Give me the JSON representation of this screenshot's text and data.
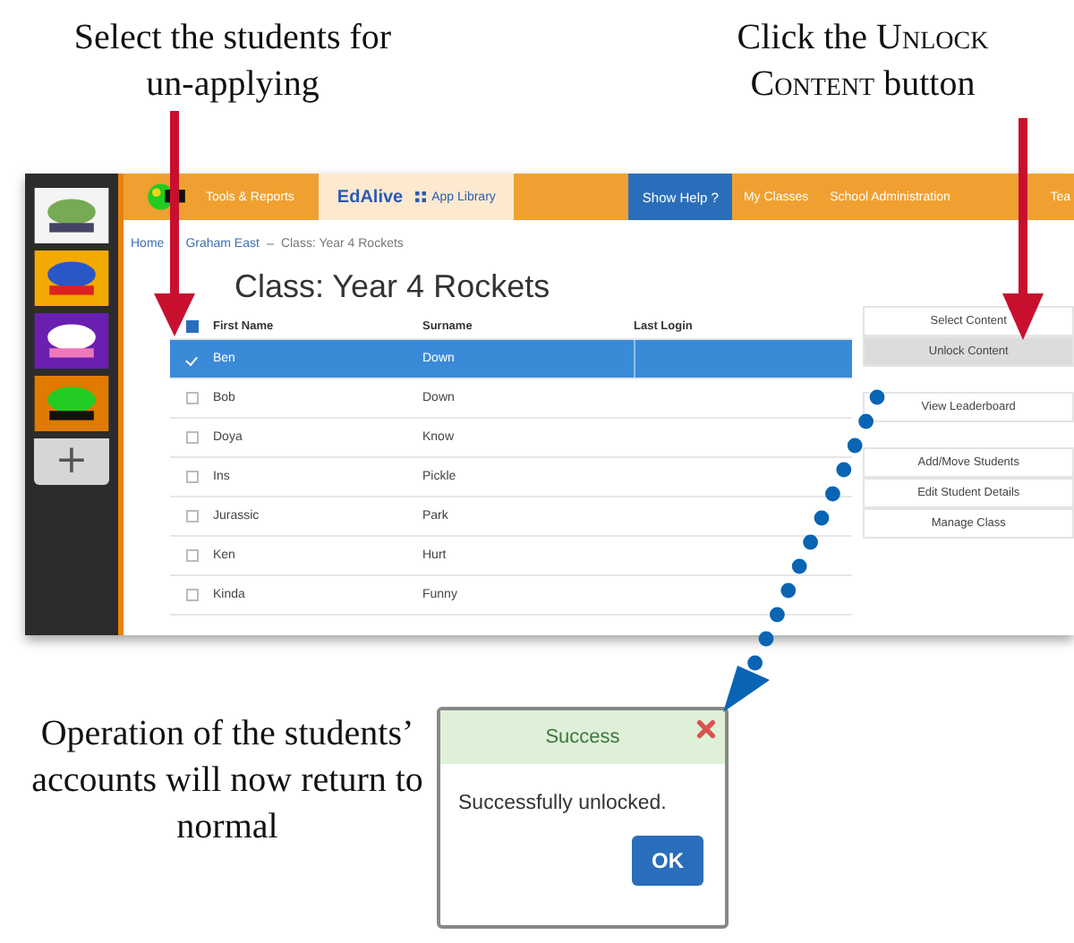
{
  "captions": {
    "top_left": "Select the students for un-applying",
    "top_right": {
      "before": "Click the",
      "emphasis": "Unlock Content",
      "after": "button"
    },
    "bottom_left": "Operation of the students’ accounts will now return to normal"
  },
  "sidebar": {
    "add_tab": "+"
  },
  "top_bar": [
    {
      "kind": "brand",
      "label": "Tools & Reports"
    },
    {
      "kind": "tab",
      "label": "EdAlive",
      "sub": "App Library"
    },
    {
      "kind": "help",
      "label": "Show Help ?"
    },
    {
      "kind": "link",
      "label": "My Classes"
    },
    {
      "kind": "link",
      "label": "School Administration"
    },
    {
      "kind": "link",
      "label": "Tea"
    }
  ],
  "breadcrumb": [
    "Home",
    "Graham East",
    "Class: Year 4 Rockets"
  ],
  "title": "Class: Year 4 Rockets",
  "table": {
    "header_checked": true,
    "columns": [
      "First Name",
      "Surname",
      "Last Login"
    ],
    "rows": [
      {
        "first": "Ben",
        "surname": "Down",
        "selected": true
      },
      {
        "first": "Bob",
        "surname": "Down",
        "selected": false
      },
      {
        "first": "Doya",
        "surname": "Know",
        "selected": false
      },
      {
        "first": "Ins",
        "surname": "Pickle",
        "selected": false
      },
      {
        "first": "Jurassic",
        "surname": "Park",
        "selected": false
      },
      {
        "first": "Ken",
        "surname": "Hurt",
        "selected": false
      },
      {
        "first": "Kinda",
        "surname": "Funny",
        "selected": false
      }
    ]
  },
  "actions": [
    [
      {
        "label": "Select Content",
        "pressed": false
      },
      {
        "label": "Unlock Content",
        "pressed": true
      }
    ],
    [
      {
        "label": "View Leaderboard",
        "pressed": false
      }
    ],
    [
      {
        "label": "Add/Move Students",
        "pressed": false
      },
      {
        "label": "Edit Student Details",
        "pressed": false
      },
      {
        "label": "Manage Class",
        "pressed": false
      }
    ]
  ],
  "dialog": {
    "title": "Success",
    "message": "Successfully unlocked.",
    "button": "OK"
  }
}
